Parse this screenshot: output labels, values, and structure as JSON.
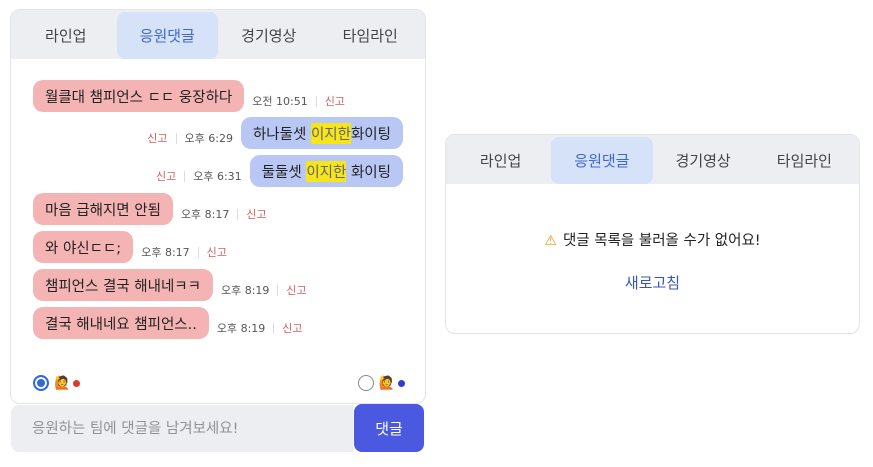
{
  "tabs": [
    "라인업",
    "응원댓글",
    "경기영상",
    "타임라인"
  ],
  "messages": [
    {
      "side": "left",
      "text": "월클대 챔피언스 ㄷㄷ 웅장하다",
      "time": "오전 10:51",
      "report": "신고"
    },
    {
      "side": "right",
      "text_before": "하나둘셋 ",
      "text_hl": "이지한",
      "text_after": "화이팅",
      "time": "오후 6:29",
      "report": "신고"
    },
    {
      "side": "right",
      "text_before": "둘둘셋 ",
      "text_hl": "이지한",
      "text_after": " 화이팅",
      "time": "오후 6:31",
      "report": "신고"
    },
    {
      "side": "left",
      "text": "마음 급해지면 안됨",
      "time": "오후 8:17",
      "report": "신고"
    },
    {
      "side": "left",
      "text": "와 야신ㄷㄷ;",
      "time": "오후 8:17",
      "report": "신고"
    },
    {
      "side": "left",
      "text": "챔피언스 결국 해내네ㅋㅋ",
      "time": "오후 8:19",
      "report": "신고"
    },
    {
      "side": "left",
      "text": "결국 해내네요 챔피언스..",
      "time": "오후 8:19",
      "report": "신고"
    }
  ],
  "team_select": {
    "left": {
      "checked": true,
      "emoji": "🙋",
      "dot_color": "#d63b2f"
    },
    "right": {
      "checked": false,
      "emoji": "🙋",
      "dot_color": "#2f3fd6"
    }
  },
  "comment": {
    "placeholder": "응원하는 팀에 댓글을 남겨보세요!",
    "submit_label": "댓글"
  },
  "error": {
    "icon": "⚠",
    "message": "댓글 목록을 불러올 수가 없어요!",
    "refresh_label": "새로고침"
  },
  "colors": {
    "active_tab_bg": "#d5e2f7",
    "active_tab_text": "#3f68c9",
    "left_bubble": "#f4b4b4",
    "right_bubble": "#b9c7f5",
    "submit_bg": "#4a59e0"
  }
}
